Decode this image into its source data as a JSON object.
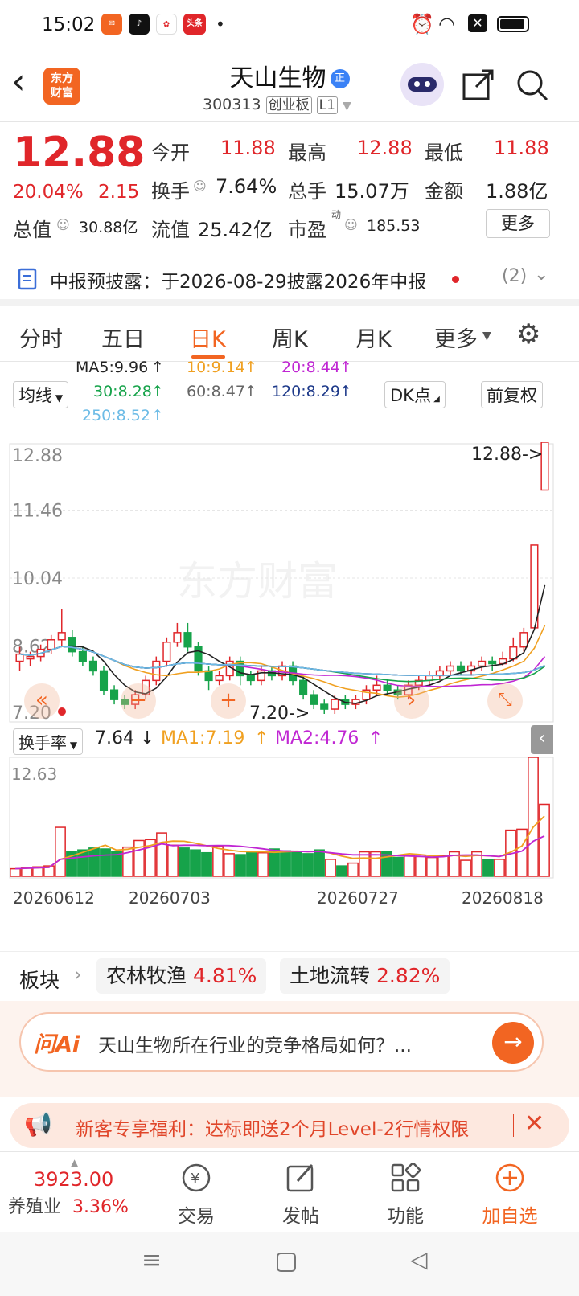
{
  "status_bar": {
    "time": "15:02",
    "app_badge": "头条"
  },
  "header": {
    "title": "天山生物",
    "title_badge": "正",
    "code": "300313",
    "board": "创业板",
    "level": "L1",
    "logo_line1": "东方",
    "logo_line2": "财富"
  },
  "quote": {
    "price": "12.88",
    "change_pct": "20.04%",
    "change": "2.15",
    "open_label": "今开",
    "open": "11.88",
    "high_label": "最高",
    "high": "12.88",
    "low_label": "最低",
    "low": "11.88",
    "turnover_label": "换手",
    "turnover": "7.64%",
    "volume_label": "总手",
    "volume": "15.07万",
    "amount_label": "金额",
    "amount": "1.88亿",
    "mcap_label": "总值",
    "mcap": "30.88亿",
    "float_label": "流值",
    "float": "25.42亿",
    "pe_label": "市盈",
    "pe_sup": "动",
    "pe": "185.53",
    "more": "更多"
  },
  "notice": {
    "text": "中报预披露：于2026-08-29披露2026年中报",
    "count": "(2)"
  },
  "tabs": [
    "分时",
    "五日",
    "日K",
    "周K",
    "月K",
    "更多"
  ],
  "active_tab": 2,
  "ma": {
    "ma5": "MA5:9.96",
    "ma10": "10:9.14",
    "ma20": "20:8.44",
    "ma30": "30:8.28",
    "ma60": "60:8.47",
    "ma120": "120:8.29",
    "ma250": "250:8.52",
    "selector": "均线",
    "dk": "DK点",
    "adjust": "前复权"
  },
  "colors": {
    "up": "#e0262a",
    "down": "#16a34a",
    "ma5": "#222222",
    "ma10": "#f0a020",
    "ma20": "#c026d3",
    "ma30": "#16a34a",
    "ma60": "#888888",
    "ma120": "#1e3a8a",
    "ma250": "#6cbbe6",
    "accent": "#f26522"
  },
  "chart_data": {
    "type": "candlestick",
    "y_ticks": [
      "12.88",
      "11.46",
      "10.04",
      "8.62",
      "7.20"
    ],
    "ylim": [
      7.2,
      12.88
    ],
    "annotations": [
      "12.88->",
      "7.20->"
    ],
    "watermark": "东方财富",
    "candles": [
      [
        8.3,
        8.45,
        8.1,
        8.6
      ],
      [
        8.35,
        8.4,
        8.2,
        8.5
      ],
      [
        8.4,
        8.55,
        8.3,
        8.65
      ],
      [
        8.55,
        8.75,
        8.45,
        8.85
      ],
      [
        8.75,
        8.9,
        8.6,
        9.4
      ],
      [
        8.8,
        8.5,
        8.4,
        8.95
      ],
      [
        8.5,
        8.3,
        8.2,
        8.6
      ],
      [
        8.3,
        8.1,
        8.0,
        8.4
      ],
      [
        8.1,
        7.7,
        7.6,
        8.2
      ],
      [
        7.7,
        7.5,
        7.4,
        7.8
      ],
      [
        7.5,
        7.4,
        7.3,
        7.6
      ],
      [
        7.4,
        7.6,
        7.3,
        7.7
      ],
      [
        7.6,
        7.9,
        7.5,
        8.0
      ],
      [
        7.9,
        8.3,
        7.8,
        8.4
      ],
      [
        8.3,
        8.7,
        8.2,
        8.8
      ],
      [
        8.7,
        8.9,
        8.6,
        9.1
      ],
      [
        8.9,
        8.6,
        8.5,
        9.1
      ],
      [
        8.6,
        8.1,
        8.0,
        8.7
      ],
      [
        8.1,
        7.9,
        7.7,
        8.2
      ],
      [
        7.9,
        8.0,
        7.8,
        8.1
      ],
      [
        8.0,
        8.3,
        7.9,
        8.4
      ],
      [
        8.3,
        8.0,
        7.8,
        8.4
      ],
      [
        8.0,
        7.9,
        7.8,
        8.1
      ],
      [
        7.9,
        8.1,
        7.8,
        8.2
      ],
      [
        8.1,
        8.0,
        7.9,
        8.2
      ],
      [
        8.0,
        8.2,
        7.9,
        8.3
      ],
      [
        8.2,
        7.9,
        7.8,
        8.3
      ],
      [
        7.9,
        7.6,
        7.5,
        8.0
      ],
      [
        7.6,
        7.4,
        7.3,
        7.7
      ],
      [
        7.4,
        7.3,
        7.2,
        7.5
      ],
      [
        7.3,
        7.5,
        7.2,
        7.6
      ],
      [
        7.5,
        7.4,
        7.3,
        7.6
      ],
      [
        7.4,
        7.5,
        7.3,
        7.6
      ],
      [
        7.5,
        7.7,
        7.4,
        7.8
      ],
      [
        7.7,
        7.8,
        7.6,
        8.0
      ],
      [
        7.8,
        7.7,
        7.6,
        7.9
      ],
      [
        7.7,
        7.6,
        7.5,
        7.8
      ],
      [
        7.6,
        7.8,
        7.5,
        7.9
      ],
      [
        7.8,
        7.9,
        7.7,
        8.0
      ],
      [
        7.9,
        8.0,
        7.8,
        8.1
      ],
      [
        8.0,
        8.1,
        7.9,
        8.2
      ],
      [
        8.1,
        8.2,
        8.0,
        8.3
      ],
      [
        8.2,
        8.1,
        8.0,
        8.3
      ],
      [
        8.1,
        8.2,
        8.0,
        8.3
      ],
      [
        8.2,
        8.3,
        8.1,
        8.4
      ],
      [
        8.3,
        8.25,
        8.1,
        8.4
      ],
      [
        8.25,
        8.35,
        8.2,
        8.5
      ],
      [
        8.35,
        8.6,
        8.3,
        8.8
      ],
      [
        8.6,
        8.9,
        8.5,
        9.0
      ],
      [
        9.0,
        10.73,
        9.0,
        10.73
      ],
      [
        11.88,
        12.88,
        11.88,
        12.88
      ]
    ]
  },
  "volume": {
    "label": "换手率",
    "value": "7.64",
    "ma1": "MA1:7.19",
    "ma2": "MA2:4.76",
    "y_top": "12.63",
    "dates": [
      "20260612",
      "20260703",
      "20260727",
      "20260818"
    ],
    "bars": [
      0.8,
      0.9,
      1.0,
      1.1,
      5.2,
      2.6,
      2.8,
      3.0,
      2.9,
      2.6,
      3.1,
      3.8,
      3.9,
      4.6,
      3.3,
      3.0,
      2.8,
      2.5,
      3.2,
      2.4,
      2.3,
      2.6,
      2.5,
      2.9,
      2.7,
      2.6,
      2.4,
      2.8,
      1.8,
      1.1,
      1.4,
      2.6,
      2.6,
      2.6,
      2.0,
      2.2,
      2.1,
      2.0,
      2.2,
      2.6,
      1.7,
      2.6,
      1.8,
      1.8,
      4.9,
      5.0,
      12.63,
      7.64
    ]
  },
  "sector": {
    "label": "板块",
    "items": [
      {
        "name": "农林牧渔",
        "pct": "4.81%"
      },
      {
        "name": "土地流转",
        "pct": "2.82%"
      }
    ]
  },
  "ai": {
    "logo": "问Ai",
    "question": "天山生物所在行业的竞争格局如何？..."
  },
  "promo": {
    "text": "新客专享福利：达标即送2个月Level-2行情权限"
  },
  "bottom": {
    "index_value": "3923.00",
    "index_name": "养殖业",
    "index_pct": "3.36%",
    "items": [
      "交易",
      "发帖",
      "功能",
      "加自选"
    ]
  }
}
